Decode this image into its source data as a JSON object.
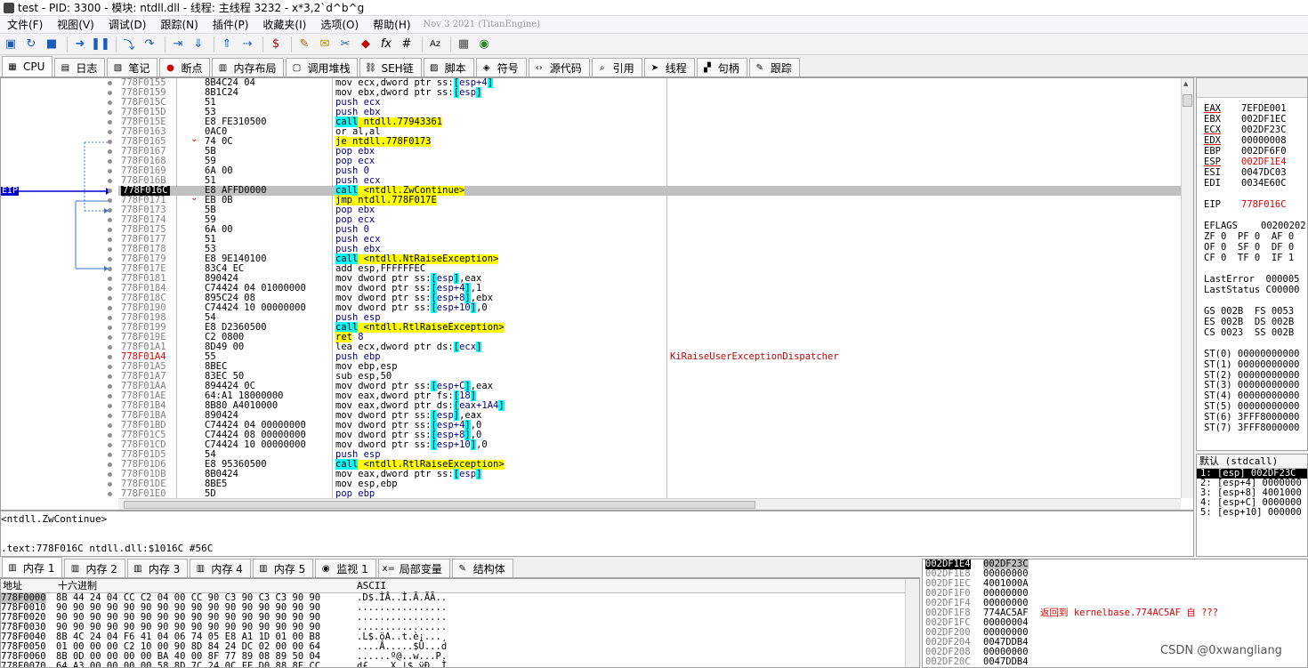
{
  "titlebar": {
    "title": "test - PID: 3300 - 模块: ntdll.dll - 线程: 主线程 3232 - x*3,2`d^b^g"
  },
  "menu": {
    "items": [
      "文件(F)",
      "视图(V)",
      "调试(D)",
      "跟踪(N)",
      "插件(P)",
      "收藏夹(I)",
      "选项(O)",
      "帮助(H)"
    ],
    "version": "Nov 3 2021 (TitanEngine)"
  },
  "tabs": [
    {
      "label": "CPU",
      "icon": "cpu-icon"
    },
    {
      "label": "日志",
      "icon": "log-icon"
    },
    {
      "label": "笔记",
      "icon": "notes-icon"
    },
    {
      "label": "断点",
      "icon": "breakpoint-icon"
    },
    {
      "label": "内存布局",
      "icon": "memory-map-icon"
    },
    {
      "label": "调用堆栈",
      "icon": "call-stack-icon"
    },
    {
      "label": "SEH链",
      "icon": "seh-icon"
    },
    {
      "label": "脚本",
      "icon": "script-icon"
    },
    {
      "label": "符号",
      "icon": "symbol-icon"
    },
    {
      "label": "源代码",
      "icon": "source-icon"
    },
    {
      "label": "引用",
      "icon": "search-icon"
    },
    {
      "label": "线程",
      "icon": "thread-icon"
    },
    {
      "label": "句柄",
      "icon": "handle-icon"
    },
    {
      "label": "跟踪",
      "icon": "trace-icon"
    }
  ],
  "eip_label": "EIP",
  "disasm": [
    {
      "addr": "778F0155",
      "bytes": "8B4C24 04",
      "ins": "mov ecx,dword ptr ss:[esp+4]",
      "kind": ""
    },
    {
      "addr": "778F0159",
      "bytes": "8B1C24",
      "ins": "mov ebx,dword ptr ss:[esp]",
      "kind": ""
    },
    {
      "addr": "778F015C",
      "bytes": "51",
      "ins": "push ecx",
      "kind": "push"
    },
    {
      "addr": "778F015D",
      "bytes": "53",
      "ins": "push ebx",
      "kind": "push"
    },
    {
      "addr": "778F015E",
      "bytes": "E8 FE310500",
      "ins": "call ntdll.77943361",
      "kind": "call"
    },
    {
      "addr": "778F0163",
      "bytes": "0AC0",
      "ins": "or al,al",
      "kind": ""
    },
    {
      "addr": "778F0165",
      "bytes": "74 0C",
      "ins": "je ntdll.778F0173",
      "kind": "jmp"
    },
    {
      "addr": "778F0167",
      "bytes": "5B",
      "ins": "pop ebx",
      "kind": "push"
    },
    {
      "addr": "778F0168",
      "bytes": "59",
      "ins": "pop ecx",
      "kind": "push"
    },
    {
      "addr": "778F0169",
      "bytes": "6A 00",
      "ins": "push 0",
      "kind": "push"
    },
    {
      "addr": "778F016B",
      "bytes": "51",
      "ins": "push ecx",
      "kind": "push"
    },
    {
      "addr": "778F016C",
      "bytes": "E8 AFFD0000",
      "ins": "call <ntdll.ZwContinue>",
      "kind": "call",
      "sel": true
    },
    {
      "addr": "778F0171",
      "bytes": "EB 0B",
      "ins": "jmp ntdll.778F017E",
      "kind": "jmp"
    },
    {
      "addr": "778F0173",
      "bytes": "5B",
      "ins": "pop ebx",
      "kind": "push"
    },
    {
      "addr": "778F0174",
      "bytes": "59",
      "ins": "pop ecx",
      "kind": "push"
    },
    {
      "addr": "778F0175",
      "bytes": "6A 00",
      "ins": "push 0",
      "kind": "push"
    },
    {
      "addr": "778F0177",
      "bytes": "51",
      "ins": "push ecx",
      "kind": "push"
    },
    {
      "addr": "778F0178",
      "bytes": "53",
      "ins": "push ebx",
      "kind": "push"
    },
    {
      "addr": "778F0179",
      "bytes": "E8 9E140100",
      "ins": "call <ntdll.NtRaiseException>",
      "kind": "call"
    },
    {
      "addr": "778F017E",
      "bytes": "83C4 EC",
      "ins": "add esp,FFFFFFEC",
      "kind": ""
    },
    {
      "addr": "778F0181",
      "bytes": "890424",
      "ins": "mov dword ptr ss:[esp],eax",
      "kind": ""
    },
    {
      "addr": "778F0184",
      "bytes": "C74424 04 01000000",
      "ins": "mov dword ptr ss:[esp+4],1",
      "kind": ""
    },
    {
      "addr": "778F018C",
      "bytes": "895C24 08",
      "ins": "mov dword ptr ss:[esp+8],ebx",
      "kind": ""
    },
    {
      "addr": "778F0190",
      "bytes": "C74424 10 00000000",
      "ins": "mov dword ptr ss:[esp+10],0",
      "kind": ""
    },
    {
      "addr": "778F0198",
      "bytes": "54",
      "ins": "push esp",
      "kind": "push"
    },
    {
      "addr": "778F0199",
      "bytes": "E8 D2360500",
      "ins": "call <ntdll.RtlRaiseException>",
      "kind": "call"
    },
    {
      "addr": "778F019E",
      "bytes": "C2 0800",
      "ins": "ret 8",
      "kind": "ret"
    },
    {
      "addr": "778F01A1",
      "bytes": "8D49 00",
      "ins": "lea ecx,dword ptr ds:[ecx]",
      "kind": ""
    },
    {
      "addr": "778F01A4",
      "bytes": "55",
      "ins": "push ebp",
      "kind": "push",
      "red": true,
      "comment": "KiRaiseUserExceptionDispatcher"
    },
    {
      "addr": "778F01A5",
      "bytes": "8BEC",
      "ins": "mov ebp,esp",
      "kind": ""
    },
    {
      "addr": "778F01A7",
      "bytes": "83EC 50",
      "ins": "sub esp,50",
      "kind": ""
    },
    {
      "addr": "778F01AA",
      "bytes": "894424 0C",
      "ins": "mov dword ptr ss:[esp+C],eax",
      "kind": ""
    },
    {
      "addr": "778F01AE",
      "bytes": "64:A1 18000000",
      "ins": "mov eax,dword ptr fs:[18]",
      "kind": ""
    },
    {
      "addr": "778F01B4",
      "bytes": "8B80 A4010000",
      "ins": "mov eax,dword ptr ds:[eax+1A4]",
      "kind": ""
    },
    {
      "addr": "778F01BA",
      "bytes": "890424",
      "ins": "mov dword ptr ss:[esp],eax",
      "kind": ""
    },
    {
      "addr": "778F01BD",
      "bytes": "C74424 04 00000000",
      "ins": "mov dword ptr ss:[esp+4],0",
      "kind": ""
    },
    {
      "addr": "778F01C5",
      "bytes": "C74424 08 00000000",
      "ins": "mov dword ptr ss:[esp+8],0",
      "kind": ""
    },
    {
      "addr": "778F01CD",
      "bytes": "C74424 10 00000000",
      "ins": "mov dword ptr ss:[esp+10],0",
      "kind": ""
    },
    {
      "addr": "778F01D5",
      "bytes": "54",
      "ins": "push esp",
      "kind": "push"
    },
    {
      "addr": "778F01D6",
      "bytes": "E8 95360500",
      "ins": "call <ntdll.RtlRaiseException>",
      "kind": "call"
    },
    {
      "addr": "778F01DB",
      "bytes": "8B0424",
      "ins": "mov eax,dword ptr ss:[esp]",
      "kind": ""
    },
    {
      "addr": "778F01DE",
      "bytes": "8BE5",
      "ins": "mov esp,ebp",
      "kind": ""
    },
    {
      "addr": "778F01E0",
      "bytes": "5D",
      "ins": "pop ebp",
      "kind": "push"
    }
  ],
  "info": {
    "line1": "<ntdll.ZwContinue>",
    "line2": ".text:778F016C ntdll.dll:$1016C #56C"
  },
  "registers": [
    {
      "n": "EAX",
      "v": "7EFDE001"
    },
    {
      "n": "EBX",
      "v": "002DF1EC"
    },
    {
      "n": "ECX",
      "v": "002DF23C"
    },
    {
      "n": "EDX",
      "v": "00000008"
    },
    {
      "n": "EBP",
      "v": "002DF6F0"
    },
    {
      "n": "ESP",
      "v": "002DF1E4",
      "red": true
    },
    {
      "n": "ESI",
      "v": "0047DC03"
    },
    {
      "n": "EDI",
      "v": "0034E60C"
    }
  ],
  "eip_reg": {
    "n": "EIP",
    "v": "778F016C"
  },
  "eflags": {
    "label": "EFLAGS",
    "value": "00200202"
  },
  "flags": [
    "ZF 0  PF 0  AF 0",
    "OF 0  SF 0  DF 0",
    "CF 0  TF 0  IF 1"
  ],
  "errors": [
    "LastError  000005",
    "LastStatus C00000"
  ],
  "segs": [
    "GS 002B  FS 0053",
    "ES 002B  DS 002B",
    "CS 0023  SS 002B"
  ],
  "fpu": [
    "ST(0) 00000000000",
    "ST(1) 00000000000",
    "ST(2) 00000000000",
    "ST(3) 00000000000",
    "ST(4) 00000000000",
    "ST(5) 00000000000",
    "ST(6) 3FFF8000000",
    "ST(7) 3FFF8000000"
  ],
  "callconv": "默认 (stdcall)",
  "stack_args": [
    "1: [esp] 002DF23C",
    "2: [esp+4] 0000000",
    "3: [esp+8] 4001000",
    "4: [esp+C] 0000000",
    "5: [esp+10] 000000"
  ],
  "memtabs": [
    "内存 1",
    "内存 2",
    "内存 3",
    "内存 4",
    "内存 5",
    "监视 1",
    "局部变量",
    "结构体"
  ],
  "dump_headers": {
    "addr": "地址",
    "hex": "十六进制",
    "ascii": "ASCII"
  },
  "dump": [
    {
      "a": "778F0000",
      "h": "8B 44 24 04 CC C2 04 00 CC 90 C3 90 C3 C3 90 90",
      "s": ".D$.ÌÂ..Ì.Ã.ÃÃ.."
    },
    {
      "a": "778F0010",
      "h": "90 90 90 90 90 90 90 90 90 90 90 90 90 90 90 90",
      "s": "................"
    },
    {
      "a": "778F0020",
      "h": "90 90 90 90 90 90 90 90 90 90 90 90 90 90 90 90",
      "s": "................"
    },
    {
      "a": "778F0030",
      "h": "90 90 90 90 90 90 90 90 90 90 90 90 90 90 90 90",
      "s": "................"
    },
    {
      "a": "778F0040",
      "h": "8B 4C 24 04 F6 41 04 06 74 05 E8 A1 1D 01 00 B8",
      "s": ".L$.öA..t.è¡...¸"
    },
    {
      "a": "778F0050",
      "h": "01 00 00 00 C2 10 00 90 8D 84 24 DC 02 00 00 64",
      "s": "....Â.....$Ü...d"
    },
    {
      "a": "778F0060",
      "h": "8B 0D 00 00 00 00 BA 40 00 8F 77 89 08 89 50 04",
      "s": "......º@..w...P."
    },
    {
      "a": "778F0070",
      "h": "64 A3 00 00 00 00 58 8D 7C 24 0C FF D0 88 8E CC",
      "s": "d£....X.|$.ÿÐ..Ì"
    }
  ],
  "stack_mem": [
    {
      "a": "002DF1E4",
      "v": "002DF23C",
      "c": "",
      "sel": true
    },
    {
      "a": "002DF1E8",
      "v": "00000000",
      "c": ""
    },
    {
      "a": "002DF1EC",
      "v": "4001000A",
      "c": ""
    },
    {
      "a": "002DF1F0",
      "v": "00000000",
      "c": ""
    },
    {
      "a": "002DF1F4",
      "v": "00000000",
      "c": ""
    },
    {
      "a": "002DF1F8",
      "v": "774AC5AF",
      "c": "返回到 kernelbase.774AC5AF 自 ???"
    },
    {
      "a": "002DF1FC",
      "v": "00000004",
      "c": ""
    },
    {
      "a": "002DF200",
      "v": "00000000",
      "c": ""
    },
    {
      "a": "002DF204",
      "v": "0047DDB4",
      "c": ""
    },
    {
      "a": "002DF208",
      "v": "00000000",
      "c": ""
    },
    {
      "a": "002DF20C",
      "v": "0047DDB4",
      "c": ""
    }
  ],
  "watermark": "CSDN @0xwangliang"
}
